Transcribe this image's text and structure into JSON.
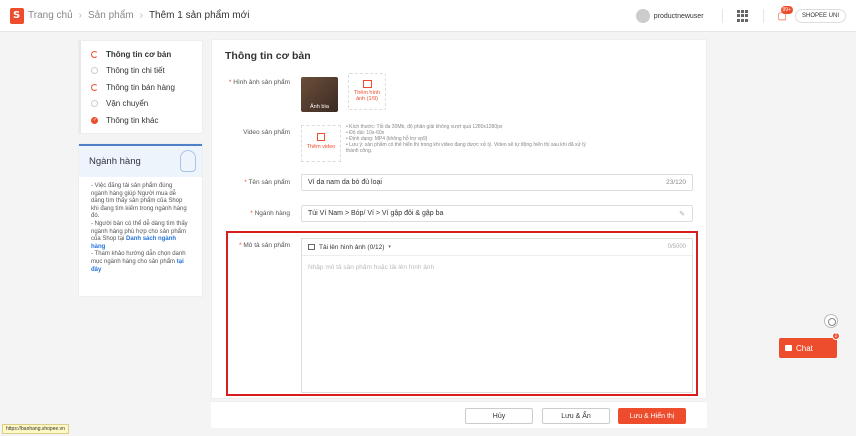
{
  "header": {
    "breadcrumb": [
      "Trang chủ",
      "Sản phẩm",
      "Thêm 1 sản phẩm mới"
    ],
    "username": "productnewuser",
    "notification_badge": "99+",
    "uni_label": "SHOPEE UNI"
  },
  "nav": {
    "items": [
      {
        "label": "Thông tin cơ bản",
        "state": "partial"
      },
      {
        "label": "Thông tin chi tiết",
        "state": "empty"
      },
      {
        "label": "Thông tin bán hàng",
        "state": "partial"
      },
      {
        "label": "Vận chuyển",
        "state": "empty"
      },
      {
        "label": "Thông tin khác",
        "state": "done"
      }
    ]
  },
  "tip": {
    "title": "Ngành hàng",
    "lines": [
      "- Việc đăng tải sản phẩm đúng ngành hàng giúp Người mua dễ dàng tìm thấy sản phẩm của Shop khi đang tìm kiếm trong ngành hàng đó.",
      "- Người bán có thể dễ dàng tìm thấy ngành hàng phù hợp cho sản phẩm của Shop tại",
      "Danh sách ngành hàng",
      "- Tham khảo hướng dẫn chọn danh mục ngành hàng cho sản phẩm",
      "tại đây"
    ]
  },
  "form": {
    "title": "Thông tin cơ bản",
    "image_label": "Hình ảnh sản phẩm",
    "cover_label": "Ảnh bìa",
    "add_image_label": "Thêm hình ảnh (1/9)",
    "video_label": "Video sản phẩm",
    "add_video_label": "Thêm video",
    "video_notes": [
      "Kích thước: Tối đa 30Mb, độ phân giải không vượt quá 1280x1280px",
      "Độ dài: 10s-60s",
      "Định dạng: MP4 (không hỗ trợ vp9)",
      "Lưu ý: sản phẩm có thể hiển thị trong khi video đang được xử lý. Video sẽ tự động hiển thị sau khi đã xử lý thành công."
    ],
    "name_label": "Tên sản phẩm",
    "name_value": "Ví da nam da bò đủ loại",
    "name_count": "23/120",
    "category_label": "Ngành hàng",
    "category_value": "Túi Ví Nam > Bóp/ Ví > Ví gập đôi & gập ba",
    "desc_label": "Mô tả sản phẩm",
    "desc_upload_label": "Tải lên hình ảnh (0/12)",
    "desc_count": "0/5000",
    "desc_placeholder": "Nhập mô tả sản phẩm hoặc tải lên hình ảnh"
  },
  "actions": {
    "cancel": "Hủy",
    "save_hide": "Lưu & Ẩn",
    "save_show": "Lưu & Hiển thị"
  },
  "status_url": "https://banhang.shopee.vn",
  "chat": {
    "label": "Chat",
    "badge": "2"
  },
  "colors": {
    "brand": "#ee4d2d",
    "highlight_outline": "#d91c1c",
    "link": "#2673dd"
  }
}
